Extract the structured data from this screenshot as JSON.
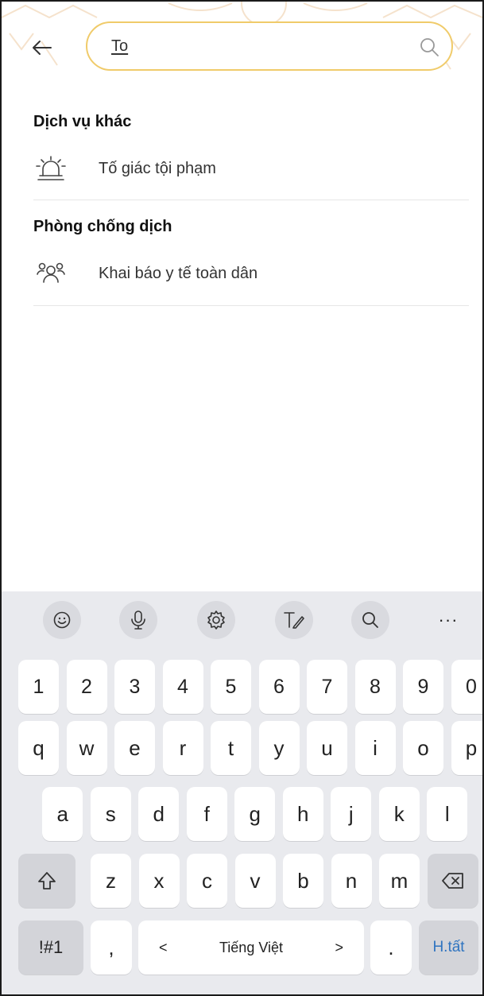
{
  "header": {
    "search_value": "To"
  },
  "sections": [
    {
      "title": "Dịch vụ khác",
      "items": [
        {
          "label": "Tố giác tội phạm",
          "icon": "alarm-siren-icon"
        }
      ]
    },
    {
      "title": "Phòng chống dịch",
      "items": [
        {
          "label": "Khai báo y tế toàn dân",
          "icon": "people-group-icon"
        }
      ]
    }
  ],
  "keyboard": {
    "toolbar": [
      "emoji-icon",
      "microphone-icon",
      "settings-icon",
      "handwriting-icon",
      "search-icon",
      "more-icon"
    ],
    "more_label": "···",
    "row_numbers": [
      "1",
      "2",
      "3",
      "4",
      "5",
      "6",
      "7",
      "8",
      "9",
      "0"
    ],
    "row1": [
      "q",
      "w",
      "e",
      "r",
      "t",
      "y",
      "u",
      "i",
      "o",
      "p"
    ],
    "row2": [
      "a",
      "s",
      "d",
      "f",
      "g",
      "h",
      "j",
      "k",
      "l"
    ],
    "row3": [
      "z",
      "x",
      "c",
      "v",
      "b",
      "n",
      "m"
    ],
    "symbols_label": "!#1",
    "comma_label": ",",
    "space_label": "Tiếng Việt",
    "space_left": "<",
    "space_right": ">",
    "period_label": ".",
    "done_label": "H.tất"
  },
  "colors": {
    "search_border": "#f0cb6a",
    "keyboard_bg": "#e9eaee",
    "done_text": "#2f74c0"
  }
}
